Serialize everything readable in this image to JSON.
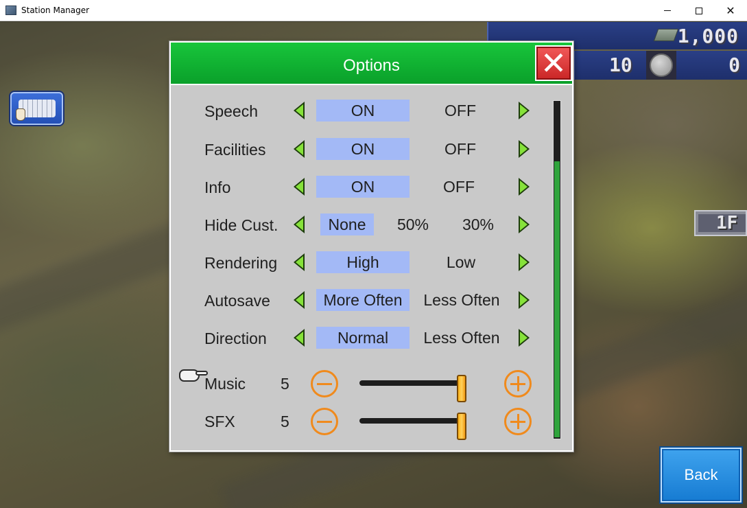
{
  "window": {
    "title": "Station Manager",
    "controls": {
      "minimize_icon": "minimize-icon",
      "maximize_icon": "maximize-icon",
      "close_glyph": "✕"
    }
  },
  "hud": {
    "money": "1,000",
    "medals": "10",
    "second_value": "0",
    "floor": "1F"
  },
  "dialog": {
    "title": "Options",
    "close_glyph": "✕",
    "rows": [
      {
        "label": "Speech",
        "options": [
          "ON",
          "OFF"
        ],
        "selected": "ON"
      },
      {
        "label": "Facilities",
        "options": [
          "ON",
          "OFF"
        ],
        "selected": "ON"
      },
      {
        "label": "Info",
        "options": [
          "ON",
          "OFF"
        ],
        "selected": "ON"
      },
      {
        "label": "Hide Cust.",
        "options": [
          "None",
          "50%",
          "30%"
        ],
        "selected": "None"
      },
      {
        "label": "Rendering",
        "options": [
          "High",
          "Low"
        ],
        "selected": "High"
      },
      {
        "label": "Autosave",
        "options": [
          "More Often",
          "Less Often"
        ],
        "selected": "More Often"
      },
      {
        "label": "Direction",
        "options": [
          "Normal",
          "Less Often"
        ],
        "selected": "Normal"
      }
    ],
    "sliders": [
      {
        "label": "Music",
        "value": "5",
        "level": 1.0
      },
      {
        "label": "SFX",
        "value": "5",
        "level": 1.0
      }
    ],
    "scroll_fraction": 0.82
  },
  "back_button": {
    "label": "Back"
  },
  "colors": {
    "header_green": "#0aa02a",
    "selected_option": "#a3b9f6",
    "arrow_green": "#86e23a",
    "slider_accent": "#f08a1c",
    "back_blue": "#167bd2",
    "close_red": "#c92525"
  }
}
